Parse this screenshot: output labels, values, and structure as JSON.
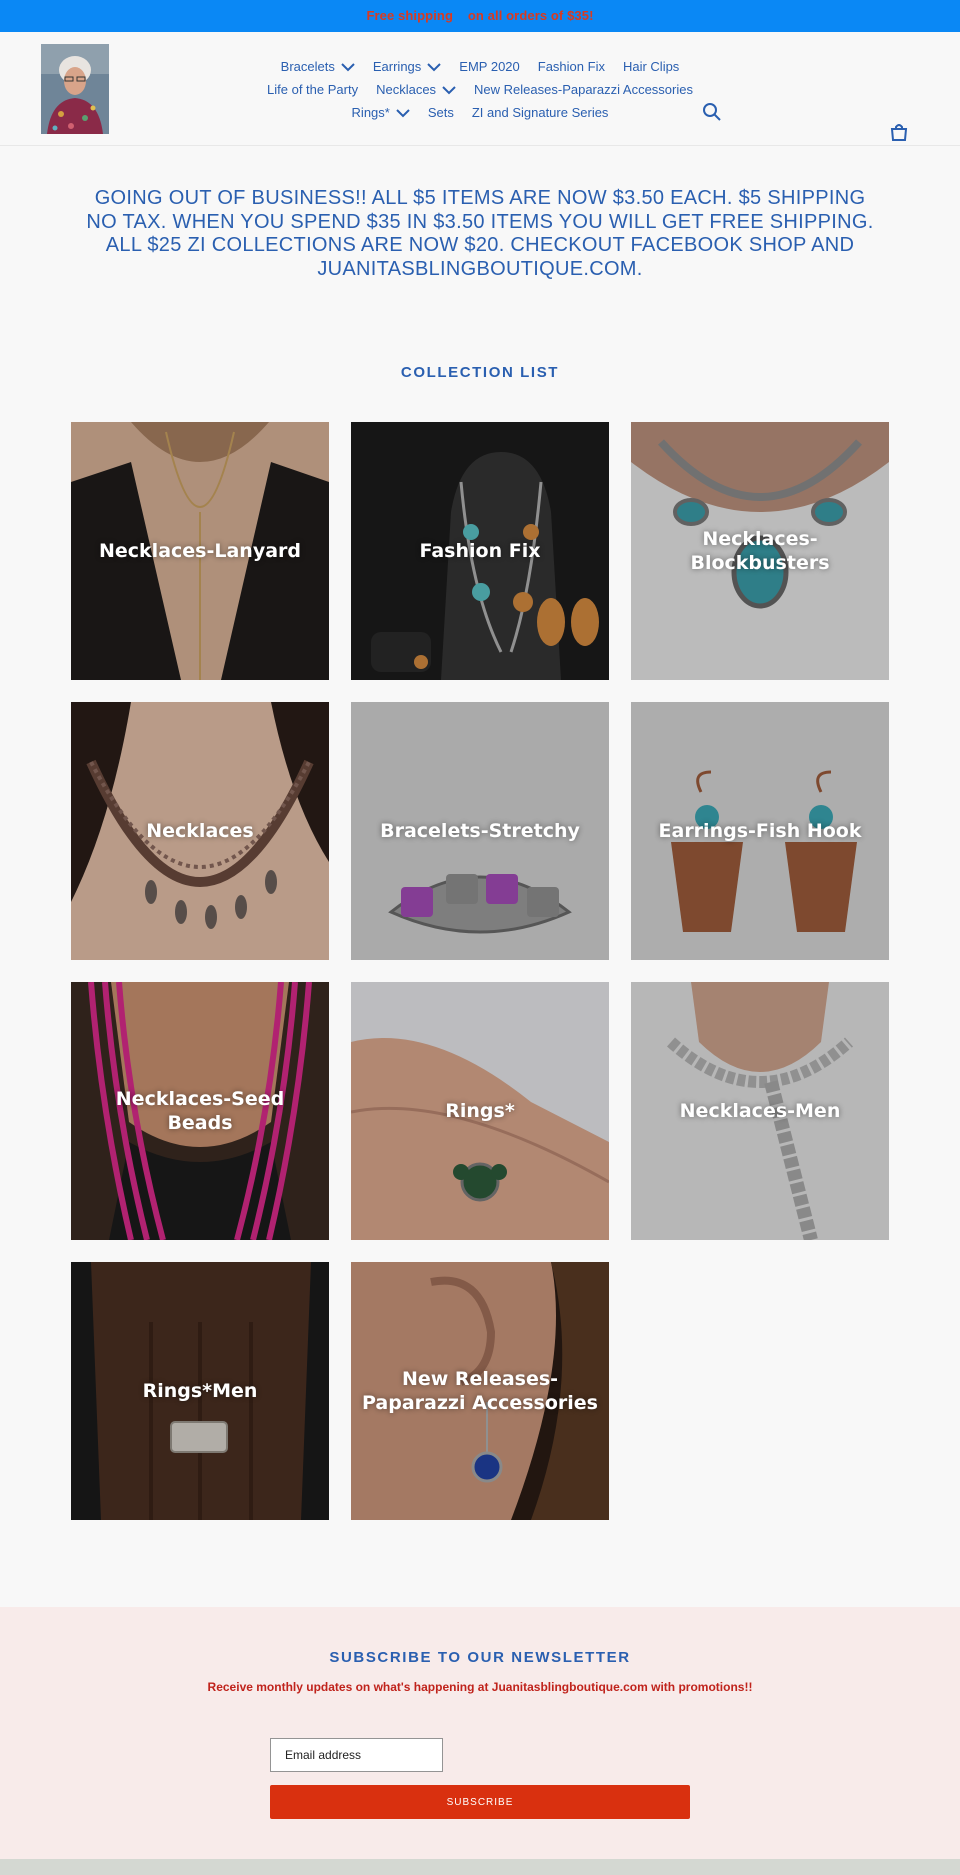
{
  "announcement": "Free shipping    on all orders of $35!",
  "nav": {
    "row1": [
      {
        "label": "Bracelets",
        "dropdown": true
      },
      {
        "label": "Earrings",
        "dropdown": true
      },
      {
        "label": "EMP 2020",
        "dropdown": false
      },
      {
        "label": "Fashion Fix",
        "dropdown": false
      },
      {
        "label": "Hair Clips",
        "dropdown": false
      }
    ],
    "row2": [
      {
        "label": "Life of the Party",
        "dropdown": false
      },
      {
        "label": "Necklaces",
        "dropdown": true
      },
      {
        "label": "New Releases-Paparazzi Accessories",
        "dropdown": false
      }
    ],
    "row3": [
      {
        "label": "Rings*",
        "dropdown": true
      },
      {
        "label": "Sets",
        "dropdown": false
      },
      {
        "label": "ZI and Signature Series",
        "dropdown": false
      }
    ]
  },
  "icons": {
    "search": "search-icon",
    "cart": "cart-icon"
  },
  "headline": "GOING OUT OF BUSINESS!! ALL $5 ITEMS ARE NOW $3.50 EACH. $5 SHIPPING NO TAX. WHEN YOU SPEND $35 IN $3.50 ITEMS YOU WILL GET FREE SHIPPING. ALL $25 ZI COLLECTIONS ARE NOW $20. CHECKOUT FACEBOOK SHOP AND JUANITASBLINGBOUTIQUE.COM.",
  "collection_title": "COLLECTION LIST",
  "collections": [
    "Necklaces-Lanyard",
    "Fashion Fix",
    "Necklaces-Blockbusters",
    "Necklaces",
    "Bracelets-Stretchy",
    "Earrings-Fish Hook",
    "Necklaces-Seed Beads",
    "Rings*",
    "Necklaces-Men",
    "Rings*Men",
    "New Releases-Paparazzi Accessories"
  ],
  "newsletter": {
    "title": "SUBSCRIBE TO OUR NEWSLETTER",
    "subtitle": "Receive monthly updates on what's happening at Juanitasblingboutique.com with promotions!!",
    "email_placeholder": "Email address",
    "button": "SUBSCRIBE"
  },
  "colors": {
    "announce_bg": "#0a88f5",
    "announce_text": "#d93a20",
    "brand_blue": "#2a5fb0",
    "subscribe_bg": "#d9300f",
    "newsletter_bg": "#f8ebea"
  }
}
